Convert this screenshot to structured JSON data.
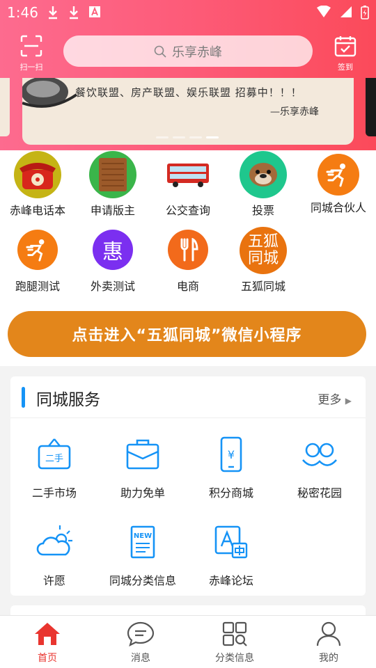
{
  "status": {
    "time": "1:46"
  },
  "header": {
    "scan_label": "扫一扫",
    "search_placeholder": "乐享赤峰",
    "checkin_label": "签到"
  },
  "banner": {
    "slogan": "餐饮联盟、房产联盟、娱乐联盟 招募中！！！",
    "signature": "—乐享赤峰",
    "active_dot": 4
  },
  "apps": [
    {
      "label": "赤峰电话本",
      "icon": "telephone-icon"
    },
    {
      "label": "申请版主",
      "icon": "wood-board-icon"
    },
    {
      "label": "公交查询",
      "icon": "bus-icon"
    },
    {
      "label": "投票",
      "icon": "bulldog-icon"
    },
    {
      "label": "同城合伙人",
      "icon": "runner-icon"
    },
    {
      "label": "跑腿测试",
      "icon": "runner-icon"
    },
    {
      "label": "外卖测试",
      "icon": "hui-icon",
      "glyph": "惠"
    },
    {
      "label": "电商",
      "icon": "fork-knife-icon"
    },
    {
      "label": "五狐同城",
      "icon": "wuhu-logo-icon",
      "glyph_top": "五狐",
      "glyph_bottom": "同城"
    }
  ],
  "cta": {
    "label": "点击进入“五狐同城”微信小程序"
  },
  "services": {
    "title": "同城服务",
    "more": "更多",
    "items": [
      {
        "label": "二手市场",
        "icon": "secondhand-tag-icon",
        "tag": "二手"
      },
      {
        "label": "助力免单",
        "icon": "briefcase-icon"
      },
      {
        "label": "积分商城",
        "icon": "phone-yen-icon"
      },
      {
        "label": "秘密花园",
        "icon": "mask-icon"
      },
      {
        "label": "许愿",
        "icon": "cloud-sun-icon"
      },
      {
        "label": "同城分类信息",
        "icon": "new-doc-icon",
        "tag": "NEW"
      },
      {
        "label": "赤峰论坛",
        "icon": "forum-a-icon"
      }
    ]
  },
  "tabs": [
    {
      "label": "首页",
      "icon": "home-icon"
    },
    {
      "label": "消息",
      "icon": "message-icon"
    },
    {
      "label": "分类信息",
      "icon": "category-icon"
    },
    {
      "label": "我的",
      "icon": "user-icon"
    }
  ],
  "colors": {
    "accent": "#fd5b78",
    "cta": "#e3861b",
    "service_blue": "#1593f6",
    "tab_active": "#e9352f"
  }
}
